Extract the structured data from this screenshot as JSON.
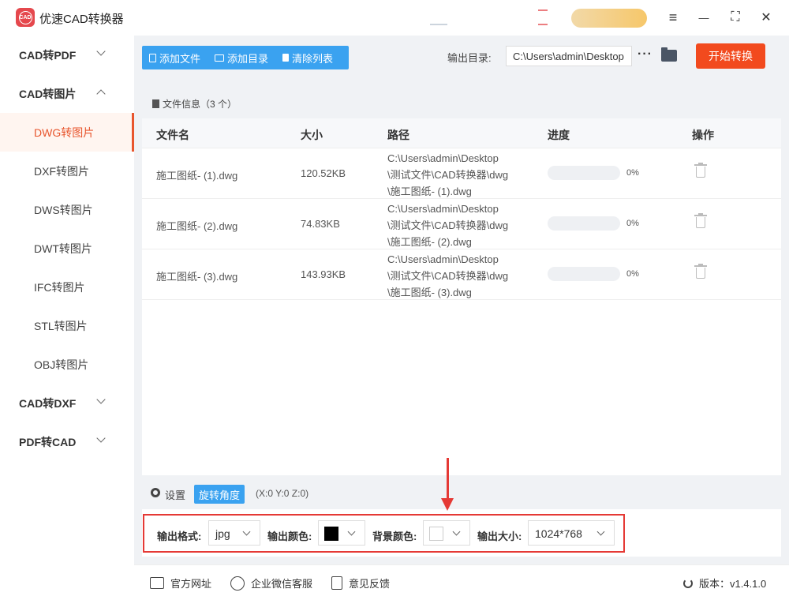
{
  "app": {
    "title": "优速CAD转换器",
    "logo_text": "CAD"
  },
  "window_controls": {
    "menu": "≡",
    "minimize": "—",
    "fullscreen": "⛶",
    "close": "✕"
  },
  "sidebar": {
    "groups": [
      {
        "label": "CAD转PDF",
        "expanded": false
      },
      {
        "label": "CAD转图片",
        "expanded": true
      },
      {
        "label": "CAD转DXF",
        "expanded": false
      },
      {
        "label": "PDF转CAD",
        "expanded": false
      }
    ],
    "items": [
      {
        "label": "DWG转图片",
        "active": true
      },
      {
        "label": "DXF转图片"
      },
      {
        "label": "DWS转图片"
      },
      {
        "label": "DWT转图片"
      },
      {
        "label": "IFC转图片"
      },
      {
        "label": "STL转图片"
      },
      {
        "label": "OBJ转图片"
      }
    ]
  },
  "toolbar": {
    "add_file": "添加文件",
    "add_folder": "添加目录",
    "clear_list": "清除列表",
    "output_label": "输出目录:",
    "output_path": "C:\\Users\\admin\\Desktop",
    "more": "···",
    "start": "开始转换"
  },
  "file_panel": {
    "header": "文件信息（3 个）",
    "columns": [
      "文件名",
      "大小",
      "路径",
      "进度",
      "操作"
    ],
    "rows": [
      {
        "name": "施工图纸- (1).dwg",
        "size": "120.52KB",
        "path_lines": [
          "C:\\Users\\admin\\Desktop",
          "\\测试文件\\CAD转换器\\dwg",
          "\\施工图纸- (1).dwg"
        ],
        "progress": "0%"
      },
      {
        "name": "施工图纸- (2).dwg",
        "size": "74.83KB",
        "path_lines": [
          "C:\\Users\\admin\\Desktop",
          "\\测试文件\\CAD转换器\\dwg",
          "\\施工图纸- (2).dwg"
        ],
        "progress": "0%"
      },
      {
        "name": "施工图纸- (3).dwg",
        "size": "143.93KB",
        "path_lines": [
          "C:\\Users\\admin\\Desktop",
          "\\测试文件\\CAD转换器\\dwg",
          "\\施工图纸- (3).dwg"
        ],
        "progress": "0%"
      }
    ]
  },
  "settings": {
    "label": "设置",
    "rotate_button": "旋转角度",
    "coords": "(X:0 Y:0 Z:0)"
  },
  "options": {
    "format_label": "输出格式:",
    "format_value": "jpg",
    "color_label": "输出颜色:",
    "color_value": "#000000",
    "bg_label": "背景颜色:",
    "bg_value": "#ffffff",
    "size_label": "输出大小:",
    "size_value": "1024*768"
  },
  "footer": {
    "website": "官方网址",
    "wechat": "企业微信客服",
    "feedback": "意见反馈",
    "version": "版本：v1.4.1.0"
  },
  "colors": {
    "accent": "#3aa2f0",
    "primary_action": "#f24a1e",
    "active_nav": "#e8552d",
    "highlight_box": "#e53935"
  }
}
